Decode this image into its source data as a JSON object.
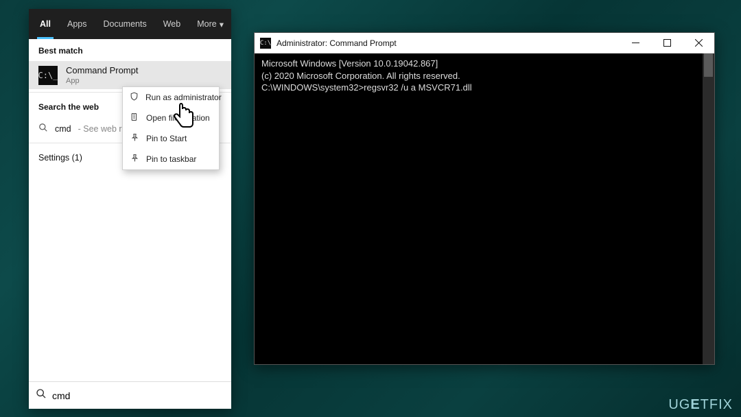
{
  "search": {
    "tabs": {
      "all": "All",
      "apps": "Apps",
      "documents": "Documents",
      "web": "Web",
      "more": "More"
    },
    "best_match_label": "Best match",
    "result": {
      "title": "Command Prompt",
      "subtitle": "App"
    },
    "context_menu": {
      "run_admin": "Run as administrator",
      "open_file_location": "Open file location",
      "pin_start": "Pin to Start",
      "pin_taskbar": "Pin to taskbar"
    },
    "web_section_label": "Search the web",
    "web_query": "cmd",
    "web_hint": " - See web results",
    "settings_label": "Settings (1)",
    "input_value": "cmd"
  },
  "cmd": {
    "title": "Administrator: Command Prompt",
    "lines": {
      "l0": "Microsoft Windows [Version 10.0.19042.867]",
      "l1": "(c) 2020 Microsoft Corporation. All rights reserved.",
      "l2": "",
      "l3": "C:\\WINDOWS\\system32>regsvr32 /u a MSVCR71.dll"
    }
  },
  "watermark": "UGETFIX"
}
